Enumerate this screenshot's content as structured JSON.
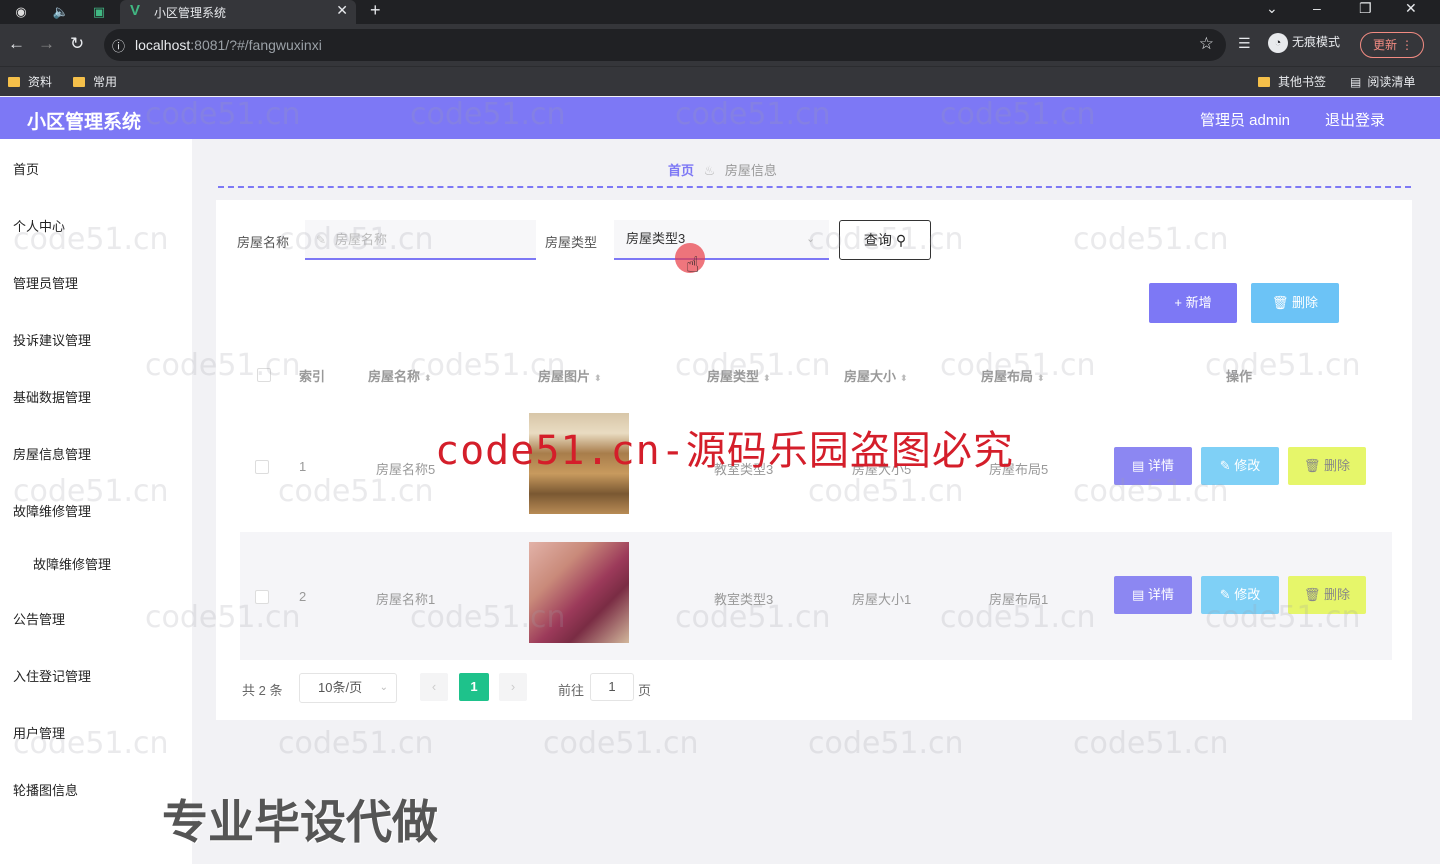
{
  "browser": {
    "tab_title": "小区管理系统",
    "favicon": "V",
    "url_host": "localhost",
    "url_rest": ":8081/?#/fangwuxinxi",
    "incognito_label": "无痕模式",
    "update_label": "更新",
    "bookmarks": [
      "资料",
      "常用"
    ],
    "other_bookmarks": "其他书签",
    "reading_list": "阅读清单",
    "icons": [
      "back-icon",
      "forward-icon",
      "reload-icon",
      "info-icon",
      "star-icon",
      "reading-list-icon",
      "incognito-icon",
      "more-icon",
      "minimize-icon",
      "maximize-icon",
      "close-icon"
    ]
  },
  "header": {
    "title": "小区管理系统",
    "admin": "管理员 admin",
    "logout": "退出登录"
  },
  "sidebar": {
    "items": [
      "首页",
      "个人中心",
      "管理员管理",
      "投诉建议管理",
      "基础数据管理",
      "房屋信息管理",
      "故障维修管理",
      "故障维修管理",
      "公告管理",
      "入住登记管理",
      "用户管理",
      "轮播图信息"
    ]
  },
  "breadcrumb": {
    "home": "首页",
    "current": "房屋信息"
  },
  "search": {
    "name_label": "房屋名称",
    "name_placeholder": "房屋名称",
    "type_label": "房屋类型",
    "type_value": "房屋类型3",
    "query_button": "查询"
  },
  "actions": {
    "add": "新增",
    "delete": "删除"
  },
  "table": {
    "columns": [
      "索引",
      "房屋名称",
      "房屋图片",
      "房屋类型",
      "房屋大小",
      "房屋布局",
      "操作"
    ],
    "rows": [
      {
        "index": "1",
        "name": "房屋名称5",
        "type": "教室类型3",
        "size": "房屋大小5",
        "layout": "房屋布局5"
      },
      {
        "index": "2",
        "name": "房屋名称1",
        "type": "教室类型3",
        "size": "房屋大小1",
        "layout": "房屋布局1"
      }
    ],
    "row_actions": {
      "detail": "详情",
      "edit": "修改",
      "delete": "删除"
    }
  },
  "pagination": {
    "total": "共 2 条",
    "page_size": "10条/页",
    "current_page": "1",
    "goto_label": "前往",
    "goto_value": "1",
    "page_suffix": "页"
  },
  "overlay": {
    "watermark": "code51.cn",
    "banner": "code51.cn-源码乐园盗图必究",
    "promo": "专业毕设代做"
  },
  "colors": {
    "accent": "#7d78f5",
    "info": "#6cc3f6",
    "warning": "#e6f66a",
    "success": "#1ec28b"
  }
}
